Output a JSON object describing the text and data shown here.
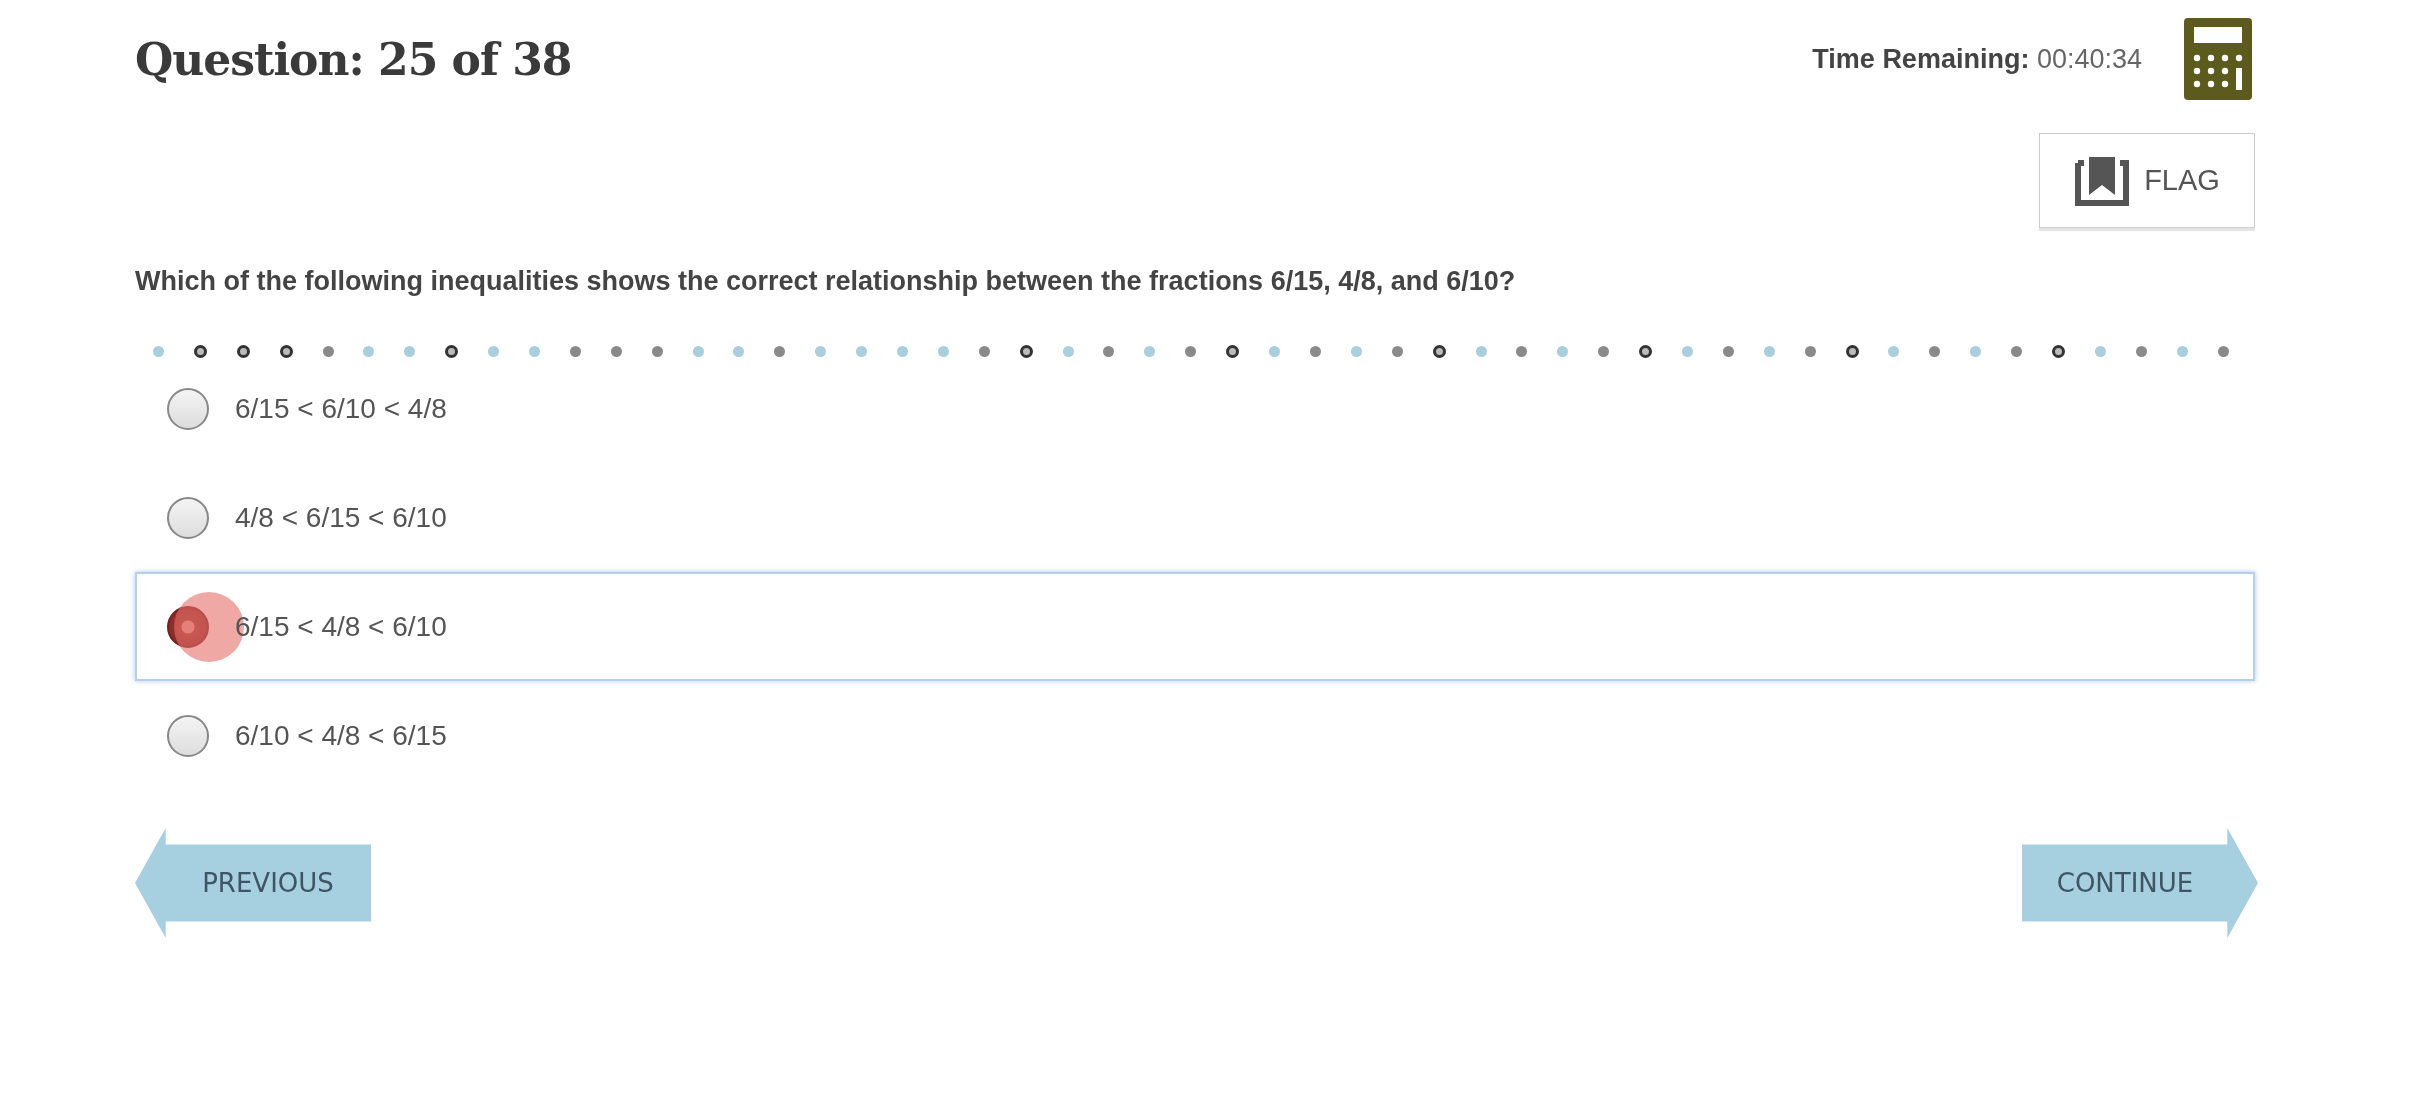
{
  "header": {
    "title": "Question: 25 of 38",
    "timer_label": "Time Remaining:",
    "timer_value": "00:40:34",
    "flag_button": "FLAG"
  },
  "question": "Which of the following inequalities shows the correct relationship between the fractions 6/15, 4/8, and 6/10?",
  "progress_dots": [
    {
      "kind": "light"
    },
    {
      "kind": "ring"
    },
    {
      "kind": "ring"
    },
    {
      "kind": "ring"
    },
    {
      "kind": "filled"
    },
    {
      "kind": "light"
    },
    {
      "kind": "light"
    },
    {
      "kind": "ring"
    },
    {
      "kind": "light"
    },
    {
      "kind": "light"
    },
    {
      "kind": "filled"
    },
    {
      "kind": "filled"
    },
    {
      "kind": "filled"
    },
    {
      "kind": "light"
    },
    {
      "kind": "light"
    },
    {
      "kind": "filled"
    },
    {
      "kind": "light"
    },
    {
      "kind": "light"
    },
    {
      "kind": "light"
    },
    {
      "kind": "light"
    },
    {
      "kind": "filled"
    },
    {
      "kind": "ring"
    },
    {
      "kind": "light"
    },
    {
      "kind": "filled"
    },
    {
      "kind": "light"
    },
    {
      "kind": "filled"
    },
    {
      "kind": "ring"
    },
    {
      "kind": "light"
    },
    {
      "kind": "filled"
    },
    {
      "kind": "light"
    },
    {
      "kind": "filled"
    },
    {
      "kind": "ring"
    },
    {
      "kind": "light"
    },
    {
      "kind": "filled"
    },
    {
      "kind": "light"
    },
    {
      "kind": "filled"
    },
    {
      "kind": "ring"
    },
    {
      "kind": "light"
    },
    {
      "kind": "filled"
    },
    {
      "kind": "light"
    },
    {
      "kind": "filled"
    },
    {
      "kind": "ring"
    },
    {
      "kind": "light"
    },
    {
      "kind": "filled"
    },
    {
      "kind": "light"
    },
    {
      "kind": "filled"
    },
    {
      "kind": "ring"
    },
    {
      "kind": "light"
    },
    {
      "kind": "filled"
    },
    {
      "kind": "light"
    },
    {
      "kind": "filled"
    }
  ],
  "options": [
    {
      "label": "6/15 < 6/10 < 4/8",
      "selected": false
    },
    {
      "label": "4/8 < 6/15 < 6/10",
      "selected": false
    },
    {
      "label": "6/15 < 4/8 < 6/10",
      "selected": true
    },
    {
      "label": "6/10 < 4/8 < 6/15",
      "selected": false
    }
  ],
  "nav": {
    "previous": "PREVIOUS",
    "continue": "CONTINUE"
  }
}
